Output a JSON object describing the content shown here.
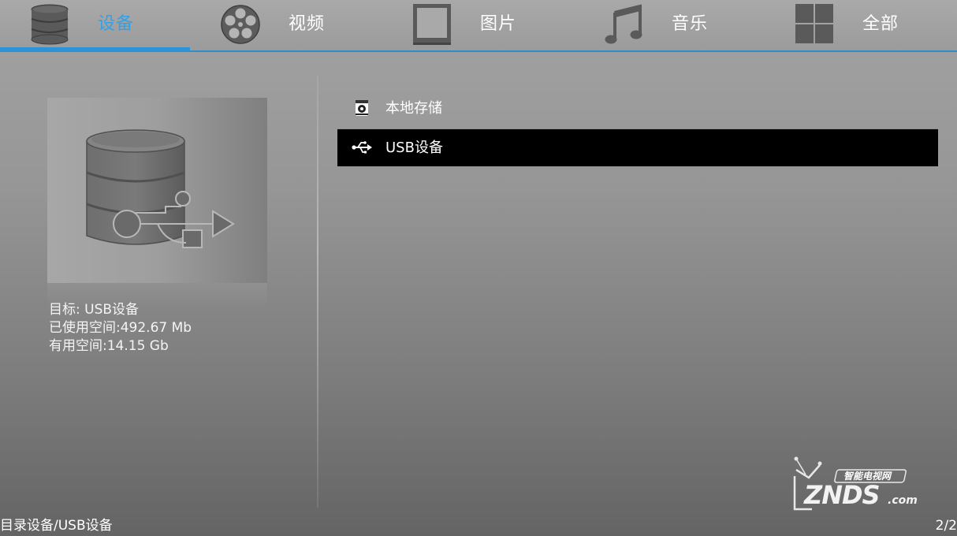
{
  "tabs": [
    {
      "label": "设备",
      "icon": "database-icon",
      "active": true
    },
    {
      "label": "视频",
      "icon": "film-reel-icon",
      "active": false
    },
    {
      "label": "图片",
      "icon": "picture-frame-icon",
      "active": false
    },
    {
      "label": "音乐",
      "icon": "music-note-icon",
      "active": false
    },
    {
      "label": "全部",
      "icon": "grid-icon",
      "active": false
    }
  ],
  "info": {
    "target": "目标: USB设备",
    "used": "已使用空间:492.67 Mb",
    "free": "有用空间:14.15 Gb"
  },
  "list": {
    "items": [
      {
        "label": "本地存储",
        "icon": "local-storage-icon",
        "selected": false
      },
      {
        "label": "USB设备",
        "icon": "usb-icon",
        "selected": true
      }
    ]
  },
  "watermark": {
    "top_text": "智能电视网",
    "brand": "ZNDS",
    "suffix": ".com"
  },
  "status": {
    "path": "目录设备/USB设备",
    "page": "2/2"
  },
  "colors": {
    "accent": "#2b93d6",
    "active_tab_text": "#35a0e3",
    "selected_row": "#000000"
  }
}
